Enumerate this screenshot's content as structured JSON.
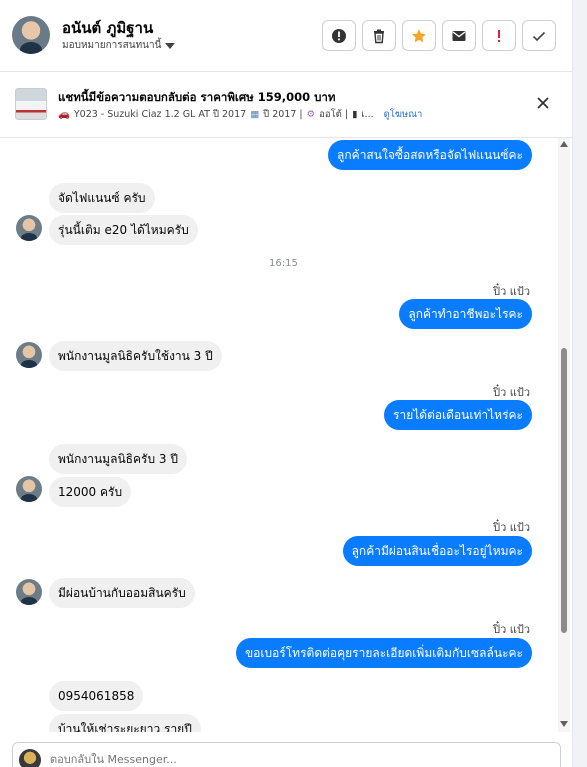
{
  "header": {
    "contact_name": "อนันต์ ภูมิฐาน",
    "assign_label": "มอบหมายการสนทนานี้",
    "actions": [
      "alert-icon",
      "trash-icon",
      "star-icon",
      "mail-icon",
      "exclamation-icon",
      "check-icon"
    ]
  },
  "ad": {
    "title": "แชทนี้มีข้อความตอบกลับต่อ ราคาพิเศษ 159,000 บาท",
    "detail_car": "Y023 - Suzuki Ciaz 1.2 GL AT ปี 2017",
    "detail_year": "ปี 2017 |",
    "detail_trans": "ออโต้ |",
    "detail_more": "เ...",
    "link": "ดูโฆษณา"
  },
  "messages": {
    "m1": "ลูกค้าสนใจซื้อสดหรือจัดไฟแนนซ์คะ",
    "m2": "จัดไฟแนนซ์ ครับ",
    "m3": "รุ่นนี้เติม e20 ได้ไหมครับ",
    "time1": "16:15",
    "agent_name": "ปิ๋ว แป้ว",
    "m4": "ลูกค้าทำอาชีพอะไรคะ",
    "m5": "พนักงานมูลนิธิครับใช้งาน 3 ปี",
    "m6": "รายได้ต่อเดือนเท่าไหร่คะ",
    "m7": "พนักงานมูลนิธิครับ 3 ปี",
    "m8": "12000 ครับ",
    "m9": "ลูกค้ามีผ่อนสินเชื่ออะไรอยู่ไหมคะ",
    "m10": "มีผ่อนบ้านกับออมสินครับ",
    "m11": "ขอเบอร์โทรติดต่อคุยรายละเอียดเพิ่มเติมกับเซลล์นะคะ",
    "m12": "0954061858",
    "m13": "บ้านให้เช่าระยะยาว รายปี"
  },
  "composer": {
    "placeholder": "ตอบกลับใน Messenger..."
  },
  "colors": {
    "outgoing": "#0a7cff",
    "incoming": "#f0f0f0",
    "star": "#f5a623",
    "alert": "#e41e3f"
  }
}
